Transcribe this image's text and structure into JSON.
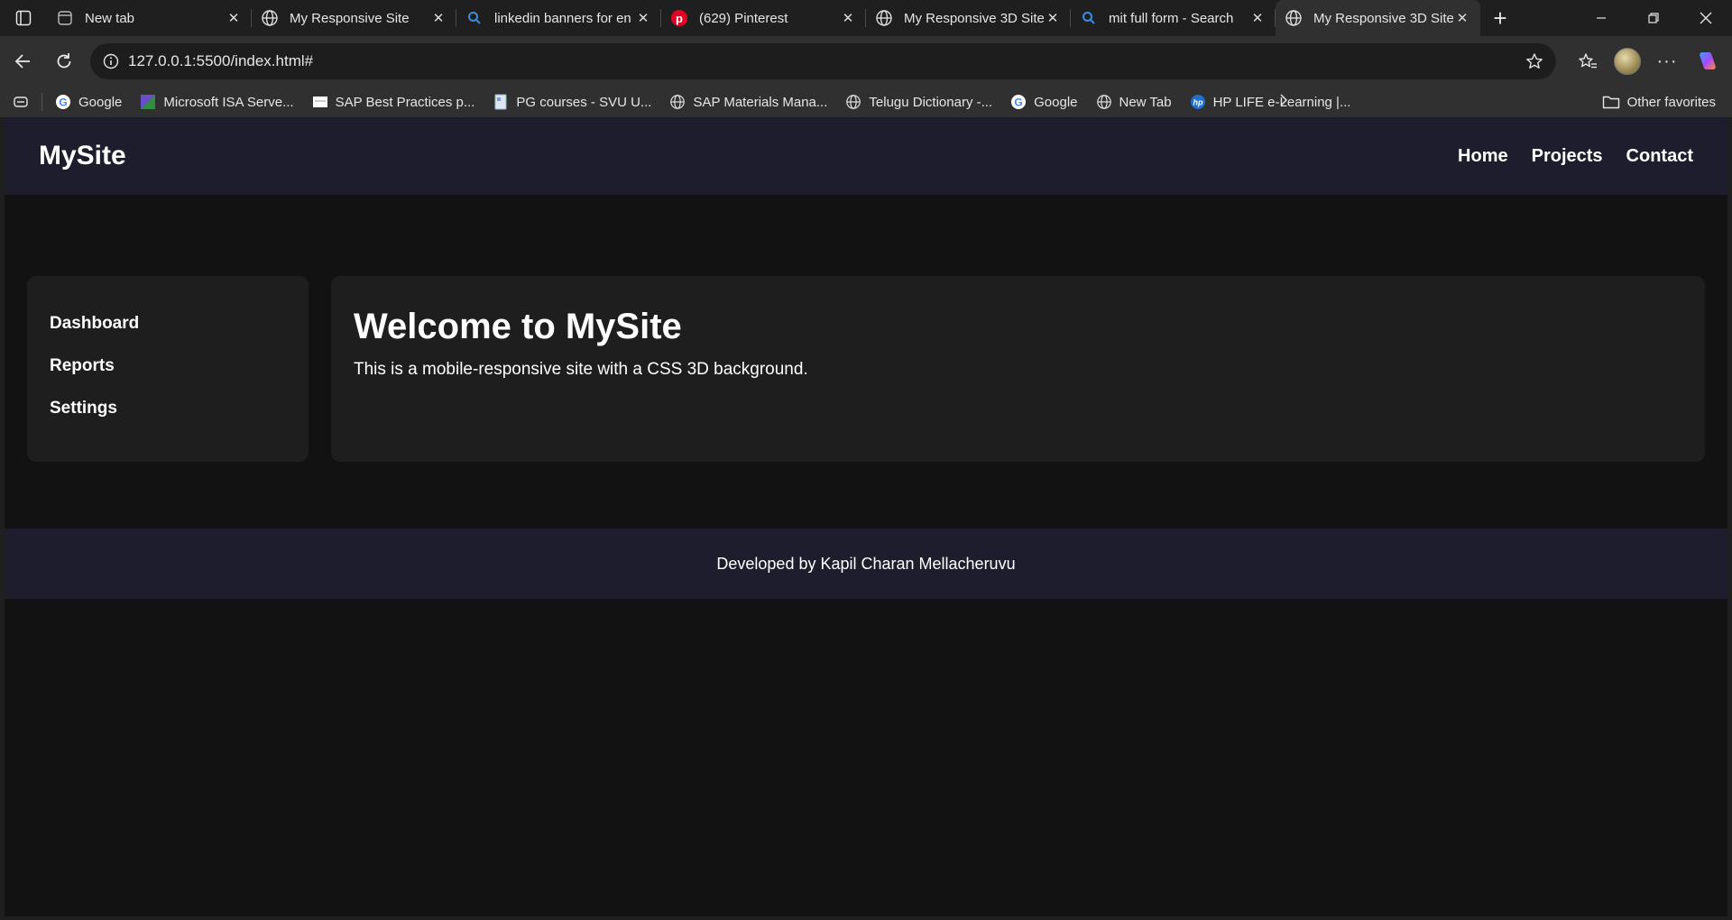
{
  "browser": {
    "tabs": [
      {
        "title": "New tab",
        "icon": "newtab-icon",
        "active": false
      },
      {
        "title": "My Responsive Site",
        "icon": "globe-icon",
        "active": false
      },
      {
        "title": "linkedin banners for en",
        "icon": "search-icon",
        "active": false
      },
      {
        "title": "(629) Pinterest",
        "icon": "pinterest-icon",
        "active": false
      },
      {
        "title": "My Responsive 3D Site",
        "icon": "globe-icon",
        "active": false
      },
      {
        "title": "mit full form - Search",
        "icon": "search-icon",
        "active": false
      },
      {
        "title": "My Responsive 3D Site",
        "icon": "globe-icon",
        "active": true
      }
    ],
    "url": "127.0.0.1:5500/index.html#",
    "bookmarks": [
      {
        "label": "Google",
        "icon": "google-icon"
      },
      {
        "label": "Microsoft ISA Serve...",
        "icon": "isa-icon"
      },
      {
        "label": "SAP Best Practices p...",
        "icon": "page-icon"
      },
      {
        "label": "PG courses - SVU U...",
        "icon": "doc-icon"
      },
      {
        "label": "SAP Materials Mana...",
        "icon": "globe-icon"
      },
      {
        "label": "Telugu Dictionary -...",
        "icon": "globe-icon"
      },
      {
        "label": "Google",
        "icon": "google-icon"
      },
      {
        "label": "New Tab",
        "icon": "globe-icon"
      },
      {
        "label": "HP LIFE e-Learning |...",
        "icon": "hp-icon"
      }
    ],
    "other_favorites": "Other favorites"
  },
  "site": {
    "logo": "MySite",
    "nav": {
      "home": "Home",
      "projects": "Projects",
      "contact": "Contact"
    },
    "sidebar": {
      "dashboard": "Dashboard",
      "reports": "Reports",
      "settings": "Settings"
    },
    "main": {
      "heading": "Welcome to MySite",
      "text": "This is a mobile-responsive site with a CSS 3D background."
    },
    "footer": "Developed by Kapil Charan Mellacheruvu"
  },
  "colors": {
    "header_bg": "#1d1d2d",
    "page_bg": "#121212",
    "card_bg": "#1e1e1e"
  }
}
